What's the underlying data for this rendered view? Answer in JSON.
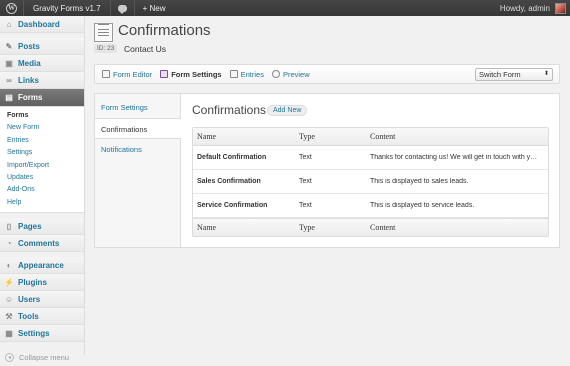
{
  "adminbar": {
    "site_name": "Gravity Forms v1.7",
    "new_label": "+ New",
    "howdy": "Howdy, admin"
  },
  "sidebar": {
    "items_top": [
      {
        "label": "Dashboard",
        "icon": "dashboard-icon"
      }
    ],
    "items_mid": [
      {
        "label": "Posts",
        "icon": "posts-icon"
      },
      {
        "label": "Media",
        "icon": "media-icon"
      },
      {
        "label": "Links",
        "icon": "links-icon"
      }
    ],
    "forms_label": "Forms",
    "forms_submenu": [
      "Forms",
      "New Form",
      "Entries",
      "Settings",
      "Import/Export",
      "Updates",
      "Add-Ons",
      "Help"
    ],
    "items_bottom1": [
      {
        "label": "Pages",
        "icon": "pages-icon"
      },
      {
        "label": "Comments",
        "icon": "comments-icon"
      }
    ],
    "items_bottom2": [
      {
        "label": "Appearance",
        "icon": "appearance-icon"
      },
      {
        "label": "Plugins",
        "icon": "plugins-icon"
      },
      {
        "label": "Users",
        "icon": "users-icon"
      },
      {
        "label": "Tools",
        "icon": "tools-icon"
      },
      {
        "label": "Settings",
        "icon": "settings-icon"
      }
    ],
    "collapse_label": "Collapse menu"
  },
  "header": {
    "title": "Confirmations",
    "form_id": "ID: 23",
    "form_name": "Contact Us"
  },
  "toolbar": {
    "form_editor": "Form Editor",
    "form_settings": "Form Settings",
    "entries": "Entries",
    "preview": "Preview",
    "switch_form": "Switch Form"
  },
  "tabs": [
    "Form Settings",
    "Confirmations",
    "Notifications"
  ],
  "main": {
    "title": "Confirmations",
    "add_new": "Add New",
    "columns": [
      "Name",
      "Type",
      "Content"
    ],
    "rows": [
      {
        "name": "Default Confirmation",
        "type": "Text",
        "content": "Thanks for contacting us! We will get in touch with you shortly."
      },
      {
        "name": "Sales Confirmation",
        "type": "Text",
        "content": "This is displayed to sales leads."
      },
      {
        "name": "Service Confirmation",
        "type": "Text",
        "content": "This is displayed to service leads."
      }
    ]
  }
}
